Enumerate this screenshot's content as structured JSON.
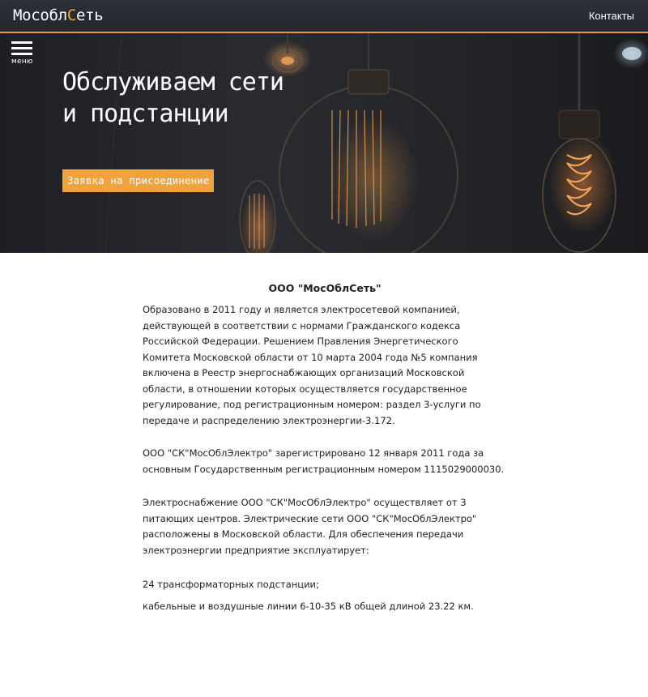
{
  "header": {
    "logo_prefix": "Мособл",
    "logo_accent": "С",
    "logo_suffix": "еть",
    "contacts_label": "Контакты"
  },
  "menu": {
    "label": "меню",
    "icon": "hamburger-icon"
  },
  "hero": {
    "title_line1": "Обслуживаем сети",
    "title_line2": "и подстанции",
    "cta_label": "Заявка на присоединение"
  },
  "about": {
    "heading": "ООО \"МосОблСеть\"",
    "paragraphs": [
      "Образовано в 2011 году и является электросетевой компанией, действующей в соответствии с нормами Гражданского кодекса Российской Федерации. Решением Правления Энергетического Комитета Московской области от 10 марта 2004 года №5 компания включена в Реестр энергоснабжающих организаций Московской области, в отношении которых осуществляется государственное регулирование, под регистрационным номером: раздел 3-услуги по передаче и распределению электроэнергии-3.172.",
      "ООО \"СК\"МосОблЭлектро\" зарегистрировано 12 января 2011 года за основным Государственным регистрационным номером 1115029000030.",
      "Электроснабжение ООО \"СК\"МосОблЭлектро\" осуществляет от 3 питающих центров. Электрические сети ООО \"СК\"МосОблЭлектро\" расположены в Московской области. Для обеспечения передачи электроэнергии предприятие эксплуатирует:",
      "24 трансформаторных подстанции;",
      "кабельные и воздушные линии 6-10-35 кВ общей длиной 23.22 км."
    ]
  },
  "colors": {
    "accent": "#f0a33c",
    "header_bg": "#262a32",
    "text": "#222222"
  }
}
